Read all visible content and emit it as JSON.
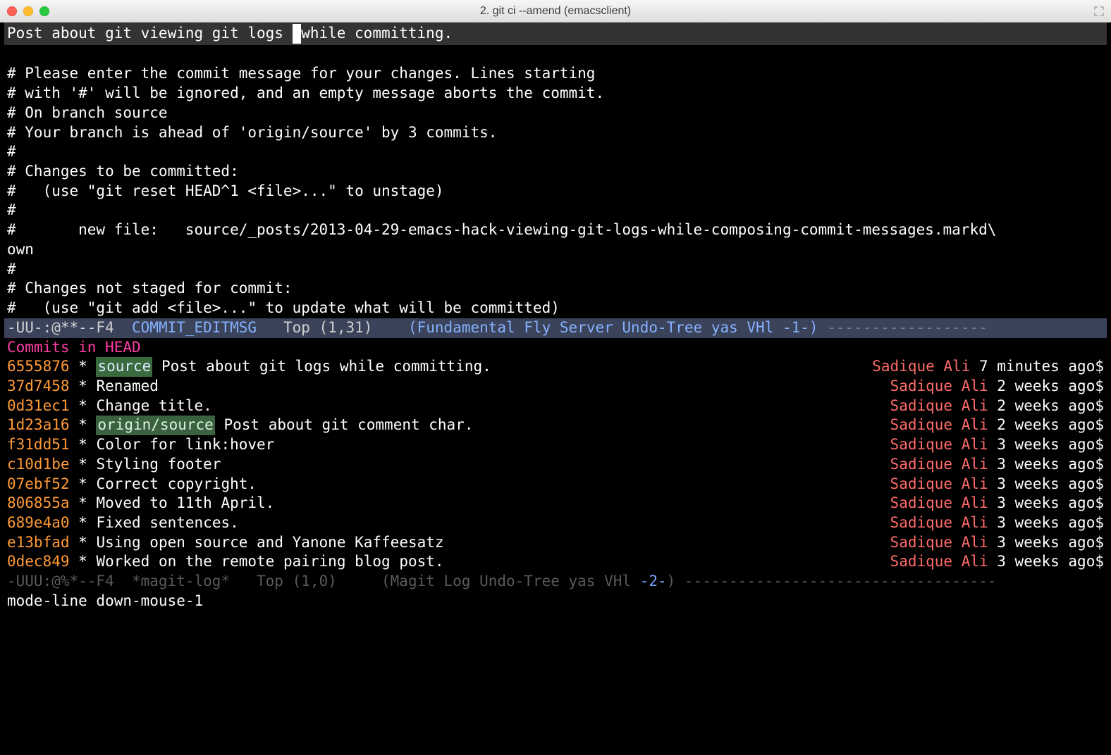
{
  "titlebar": {
    "title": "2. git ci --amend (emacsclient)"
  },
  "commit_message": {
    "before_cursor": "Post about git viewing git logs ",
    "after_cursor": "while committing."
  },
  "template_lines": [
    "",
    "# Please enter the commit message for your changes. Lines starting",
    "# with '#' will be ignored, and an empty message aborts the commit.",
    "# On branch source",
    "# Your branch is ahead of 'origin/source' by 3 commits.",
    "#",
    "# Changes to be committed:",
    "#   (use \"git reset HEAD^1 <file>...\" to unstage)",
    "#",
    "#       new file:   source/_posts/2013-04-29-emacs-hack-viewing-git-logs-while-composing-commit-messages.markd\\",
    "own",
    "#",
    "# Changes not staged for commit:",
    "#   (use \"git add <file>...\" to update what will be committed)"
  ],
  "modeline_top": {
    "left": "-UU-:@**--F4  ",
    "buffer": "COMMIT_EDITMSG",
    "pos": "   Top (1,31)    ",
    "modes": "(Fundamental Fly Server Undo-Tree yas VHl -1-)",
    "dashes": " ------------------"
  },
  "log_header": "Commits in HEAD",
  "commits": [
    {
      "hash": "6555876",
      "ref": "source",
      "msg": "Post about git logs while committing.",
      "author": "Sadique Ali",
      "when": "7 minutes ago$"
    },
    {
      "hash": "37d7458",
      "ref": null,
      "msg": "Renamed",
      "author": "Sadique Ali",
      "when": "2 weeks ago$"
    },
    {
      "hash": "0d31ec1",
      "ref": null,
      "msg": "Change title.",
      "author": "Sadique Ali",
      "when": "2 weeks ago$"
    },
    {
      "hash": "1d23a16",
      "ref": "origin/source",
      "msg": "Post about git comment char.",
      "author": "Sadique Ali",
      "when": "2 weeks ago$"
    },
    {
      "hash": "f31dd51",
      "ref": null,
      "msg": "Color for link:hover",
      "author": "Sadique Ali",
      "when": "3 weeks ago$"
    },
    {
      "hash": "c10d1be",
      "ref": null,
      "msg": "Styling footer",
      "author": "Sadique Ali",
      "when": "3 weeks ago$"
    },
    {
      "hash": "07ebf52",
      "ref": null,
      "msg": "Correct copyright.",
      "author": "Sadique Ali",
      "when": "3 weeks ago$"
    },
    {
      "hash": "806855a",
      "ref": null,
      "msg": "Moved to 11th April.",
      "author": "Sadique Ali",
      "when": "3 weeks ago$"
    },
    {
      "hash": "689e4a0",
      "ref": null,
      "msg": "Fixed sentences.",
      "author": "Sadique Ali",
      "when": "3 weeks ago$"
    },
    {
      "hash": "e13bfad",
      "ref": null,
      "msg": "Using open source and Yanone Kaffeesatz",
      "author": "Sadique Ali",
      "when": "3 weeks ago$"
    },
    {
      "hash": "0dec849",
      "ref": null,
      "msg": "Worked on the remote pairing blog post.",
      "author": "Sadique Ali",
      "when": "3 weeks ago$"
    }
  ],
  "modeline_bottom": {
    "left": "-UUU:@%*--F4  *magit-log*   Top (1,0)     (Magit Log Undo-Tree yas VHl ",
    "blue": "-2-",
    "after": ") ",
    "dashes": "-----------------------------------"
  },
  "echo_area": " mode-line down-mouse-1"
}
